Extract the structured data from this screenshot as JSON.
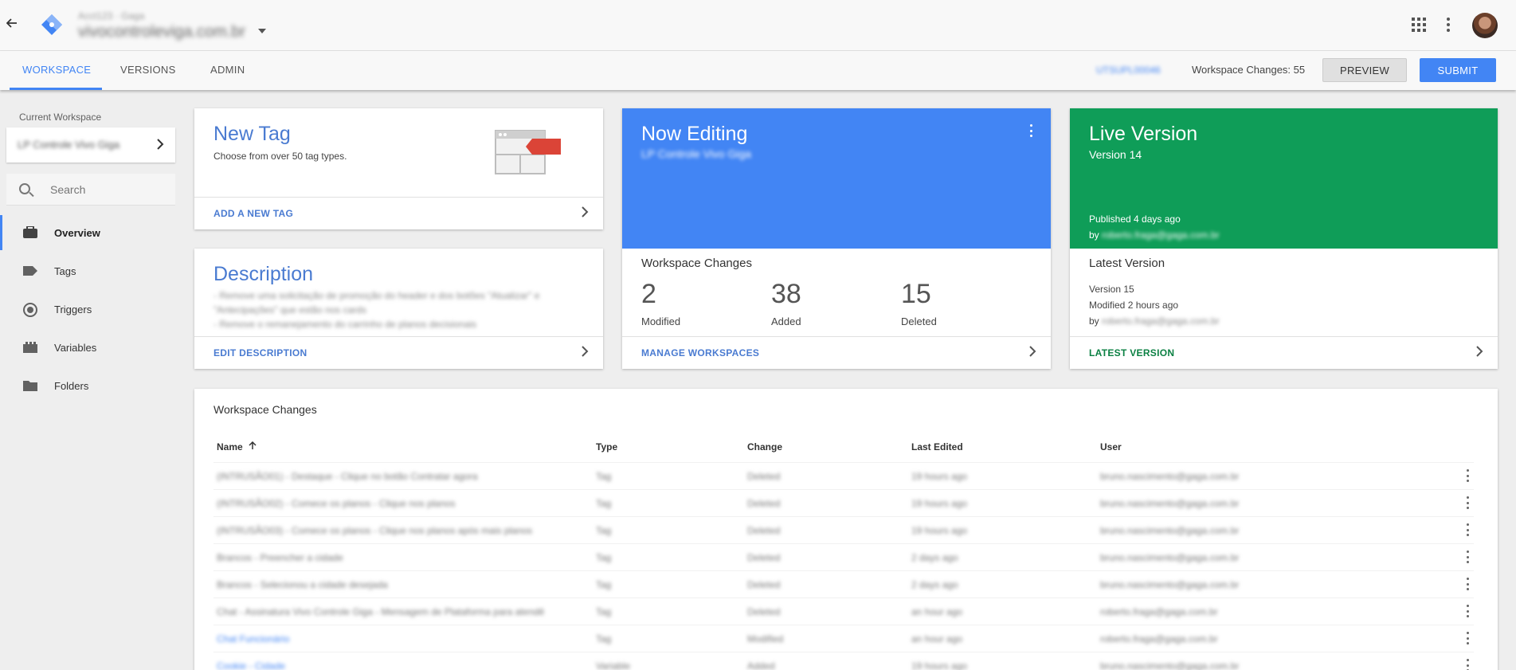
{
  "topbar": {
    "account_path": "Acct123 · Gaga",
    "container_name": "vivocontroleviga.com.br"
  },
  "tabs": [
    {
      "label": "WORKSPACE"
    },
    {
      "label": "VERSIONS"
    },
    {
      "label": "ADMIN"
    }
  ],
  "header": {
    "workspace_link": "UTSUPL00046",
    "workspace_changes": "Workspace Changes: 55",
    "preview_label": "PREVIEW",
    "submit_label": "SUBMIT"
  },
  "sidebar": {
    "current_workspace_label": "Current Workspace",
    "current_workspace_name": "LP Controle Vivo Giga",
    "search_placeholder": "Search",
    "items": [
      {
        "label": "Overview",
        "icon": "briefcase-icon"
      },
      {
        "label": "Tags",
        "icon": "tag-icon"
      },
      {
        "label": "Triggers",
        "icon": "trigger-icon"
      },
      {
        "label": "Variables",
        "icon": "variables-icon"
      },
      {
        "label": "Folders",
        "icon": "folder-icon"
      }
    ]
  },
  "new_tag_card": {
    "title": "New Tag",
    "subtitle": "Choose from over 50 tag types.",
    "footer": "ADD A NEW TAG"
  },
  "description_card": {
    "title": "Description",
    "lines": [
      "- Remove uma solicitação de promoção do header e dos botões \"Atualizar\" e",
      "\"Antecipações\" que estão nos cards",
      "- Remove o remanejamento do carrinho de planos decisionais"
    ],
    "footer": "EDIT DESCRIPTION"
  },
  "now_editing_card": {
    "title": "Now Editing",
    "subtitle": "LP Controle Vivo Giga",
    "section": "Workspace Changes",
    "stats": [
      {
        "value": "2",
        "label": "Modified"
      },
      {
        "value": "38",
        "label": "Added"
      },
      {
        "value": "15",
        "label": "Deleted"
      }
    ],
    "footer": "MANAGE WORKSPACES"
  },
  "live_version_card": {
    "title": "Live Version",
    "subtitle": "Version 14",
    "published": "Published 4 days ago",
    "by_prefix": "by",
    "by_user": "roberto.fraga@gaga.com.br",
    "section": "Latest Version",
    "latest_version": "Version 15",
    "latest_modified": "Modified 2 hours ago",
    "latest_by_user": "roberto.fraga@gaga.com.br",
    "footer": "LATEST VERSION"
  },
  "changes_table": {
    "title": "Workspace Changes",
    "columns": [
      "Name",
      "Type",
      "Change",
      "Last Edited",
      "User"
    ],
    "rows": [
      {
        "name": "(INTRUSÃO01) - Destaque - Clique no botão Contratar agora",
        "type": "Tag",
        "change": "Deleted",
        "edited": "19 hours ago",
        "user": "bruno.nascimento@gaga.com.br",
        "link": false
      },
      {
        "name": "(INTRUSÃO02) - Comece os planos - Clique nos planos",
        "type": "Tag",
        "change": "Deleted",
        "edited": "19 hours ago",
        "user": "bruno.nascimento@gaga.com.br",
        "link": false
      },
      {
        "name": "(INTRUSÃO03) - Comece os planos - Clique nos planos após mais planos",
        "type": "Tag",
        "change": "Deleted",
        "edited": "19 hours ago",
        "user": "bruno.nascimento@gaga.com.br",
        "link": false
      },
      {
        "name": "Brancos - Preencher a cidade",
        "type": "Tag",
        "change": "Deleted",
        "edited": "2 days ago",
        "user": "bruno.nascimento@gaga.com.br",
        "link": false
      },
      {
        "name": "Brancos - Selecionou a cidade desejada",
        "type": "Tag",
        "change": "Deleted",
        "edited": "2 days ago",
        "user": "bruno.nascimento@gaga.com.br",
        "link": false
      },
      {
        "name": "Chat - Assinatura Vivo Controle Giga - Mensagem de Plataforma para atendê",
        "type": "Tag",
        "change": "Deleted",
        "edited": "an hour ago",
        "user": "roberto.fraga@gaga.com.br",
        "link": false
      },
      {
        "name": "Chat Funcionário",
        "type": "Tag",
        "change": "Modified",
        "edited": "an hour ago",
        "user": "roberto.fraga@gaga.com.br",
        "link": true
      },
      {
        "name": "Cookie - Cidade",
        "type": "Variable",
        "change": "Added",
        "edited": "19 hours ago",
        "user": "bruno.nascimento@gaga.com.br",
        "link": true
      }
    ]
  }
}
